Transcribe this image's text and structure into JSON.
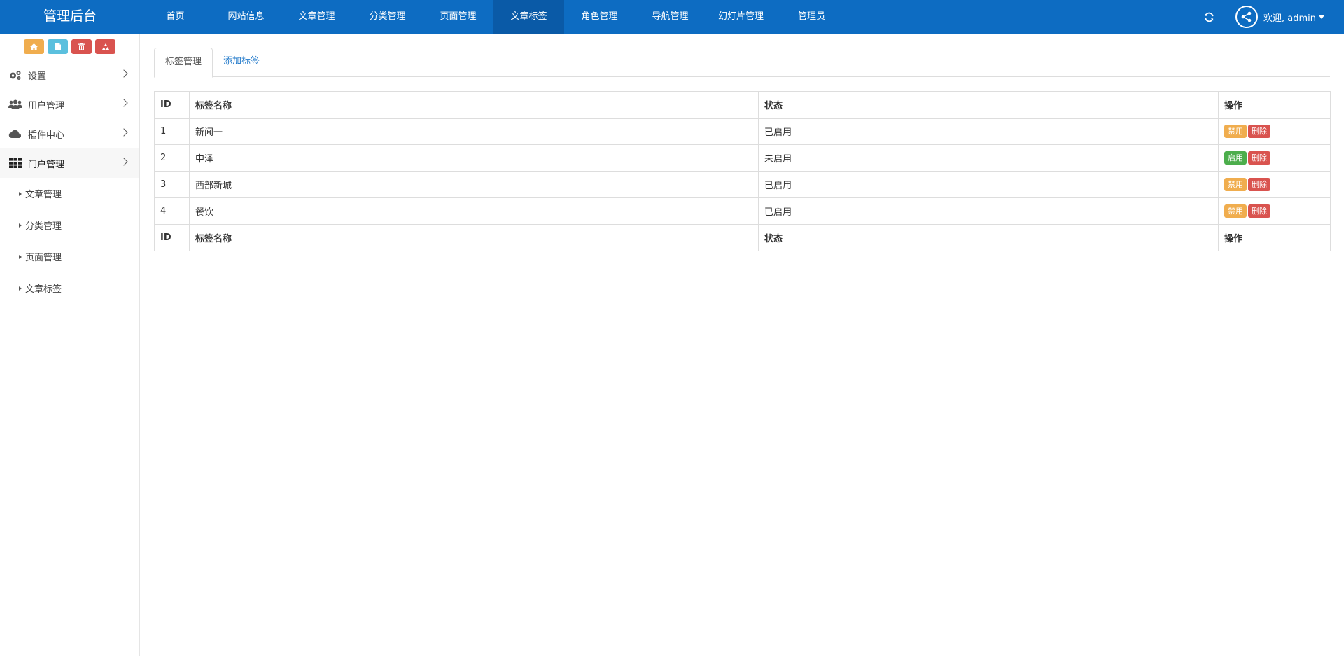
{
  "brand": "管理后台",
  "nav": {
    "items": [
      "首页",
      "网站信息",
      "文章管理",
      "分类管理",
      "页面管理",
      "文章标签",
      "角色管理",
      "导航管理",
      "幻灯片管理",
      "管理员"
    ],
    "active_index": 5,
    "welcome": "欢迎, admin"
  },
  "sidebar": {
    "shortcut_icons": [
      "home-icon",
      "file-icon",
      "trash-icon",
      "recycle-icon"
    ],
    "menu": [
      {
        "label": "设置",
        "icon": "gears-icon"
      },
      {
        "label": "用户管理",
        "icon": "users-icon"
      },
      {
        "label": "插件中心",
        "icon": "cloud-icon"
      },
      {
        "label": "门户管理",
        "icon": "grid-icon"
      }
    ],
    "submenu": [
      "文章管理",
      "分类管理",
      "页面管理",
      "文章标签"
    ]
  },
  "tabs": {
    "manage": "标签管理",
    "add": "添加标签"
  },
  "table": {
    "headers": {
      "id": "ID",
      "name": "标签名称",
      "status": "状态",
      "action": "操作"
    },
    "rows": [
      {
        "id": "1",
        "name": "新闻一",
        "status": "已启用",
        "toggle": "禁用",
        "delete": "删除"
      },
      {
        "id": "2",
        "name": "中泽",
        "status": "未启用",
        "toggle": "启用",
        "delete": "删除"
      },
      {
        "id": "3",
        "name": "西部新城",
        "status": "已启用",
        "toggle": "禁用",
        "delete": "删除"
      },
      {
        "id": "4",
        "name": "餐饮",
        "status": "已启用",
        "toggle": "禁用",
        "delete": "删除"
      }
    ]
  },
  "colors": {
    "navbar": "#0d6cc2",
    "nav_active": "#0a5aa7",
    "warning": "#f0ad4e",
    "danger": "#d9534f",
    "success": "#4cae4c",
    "info": "#5bc0de"
  }
}
